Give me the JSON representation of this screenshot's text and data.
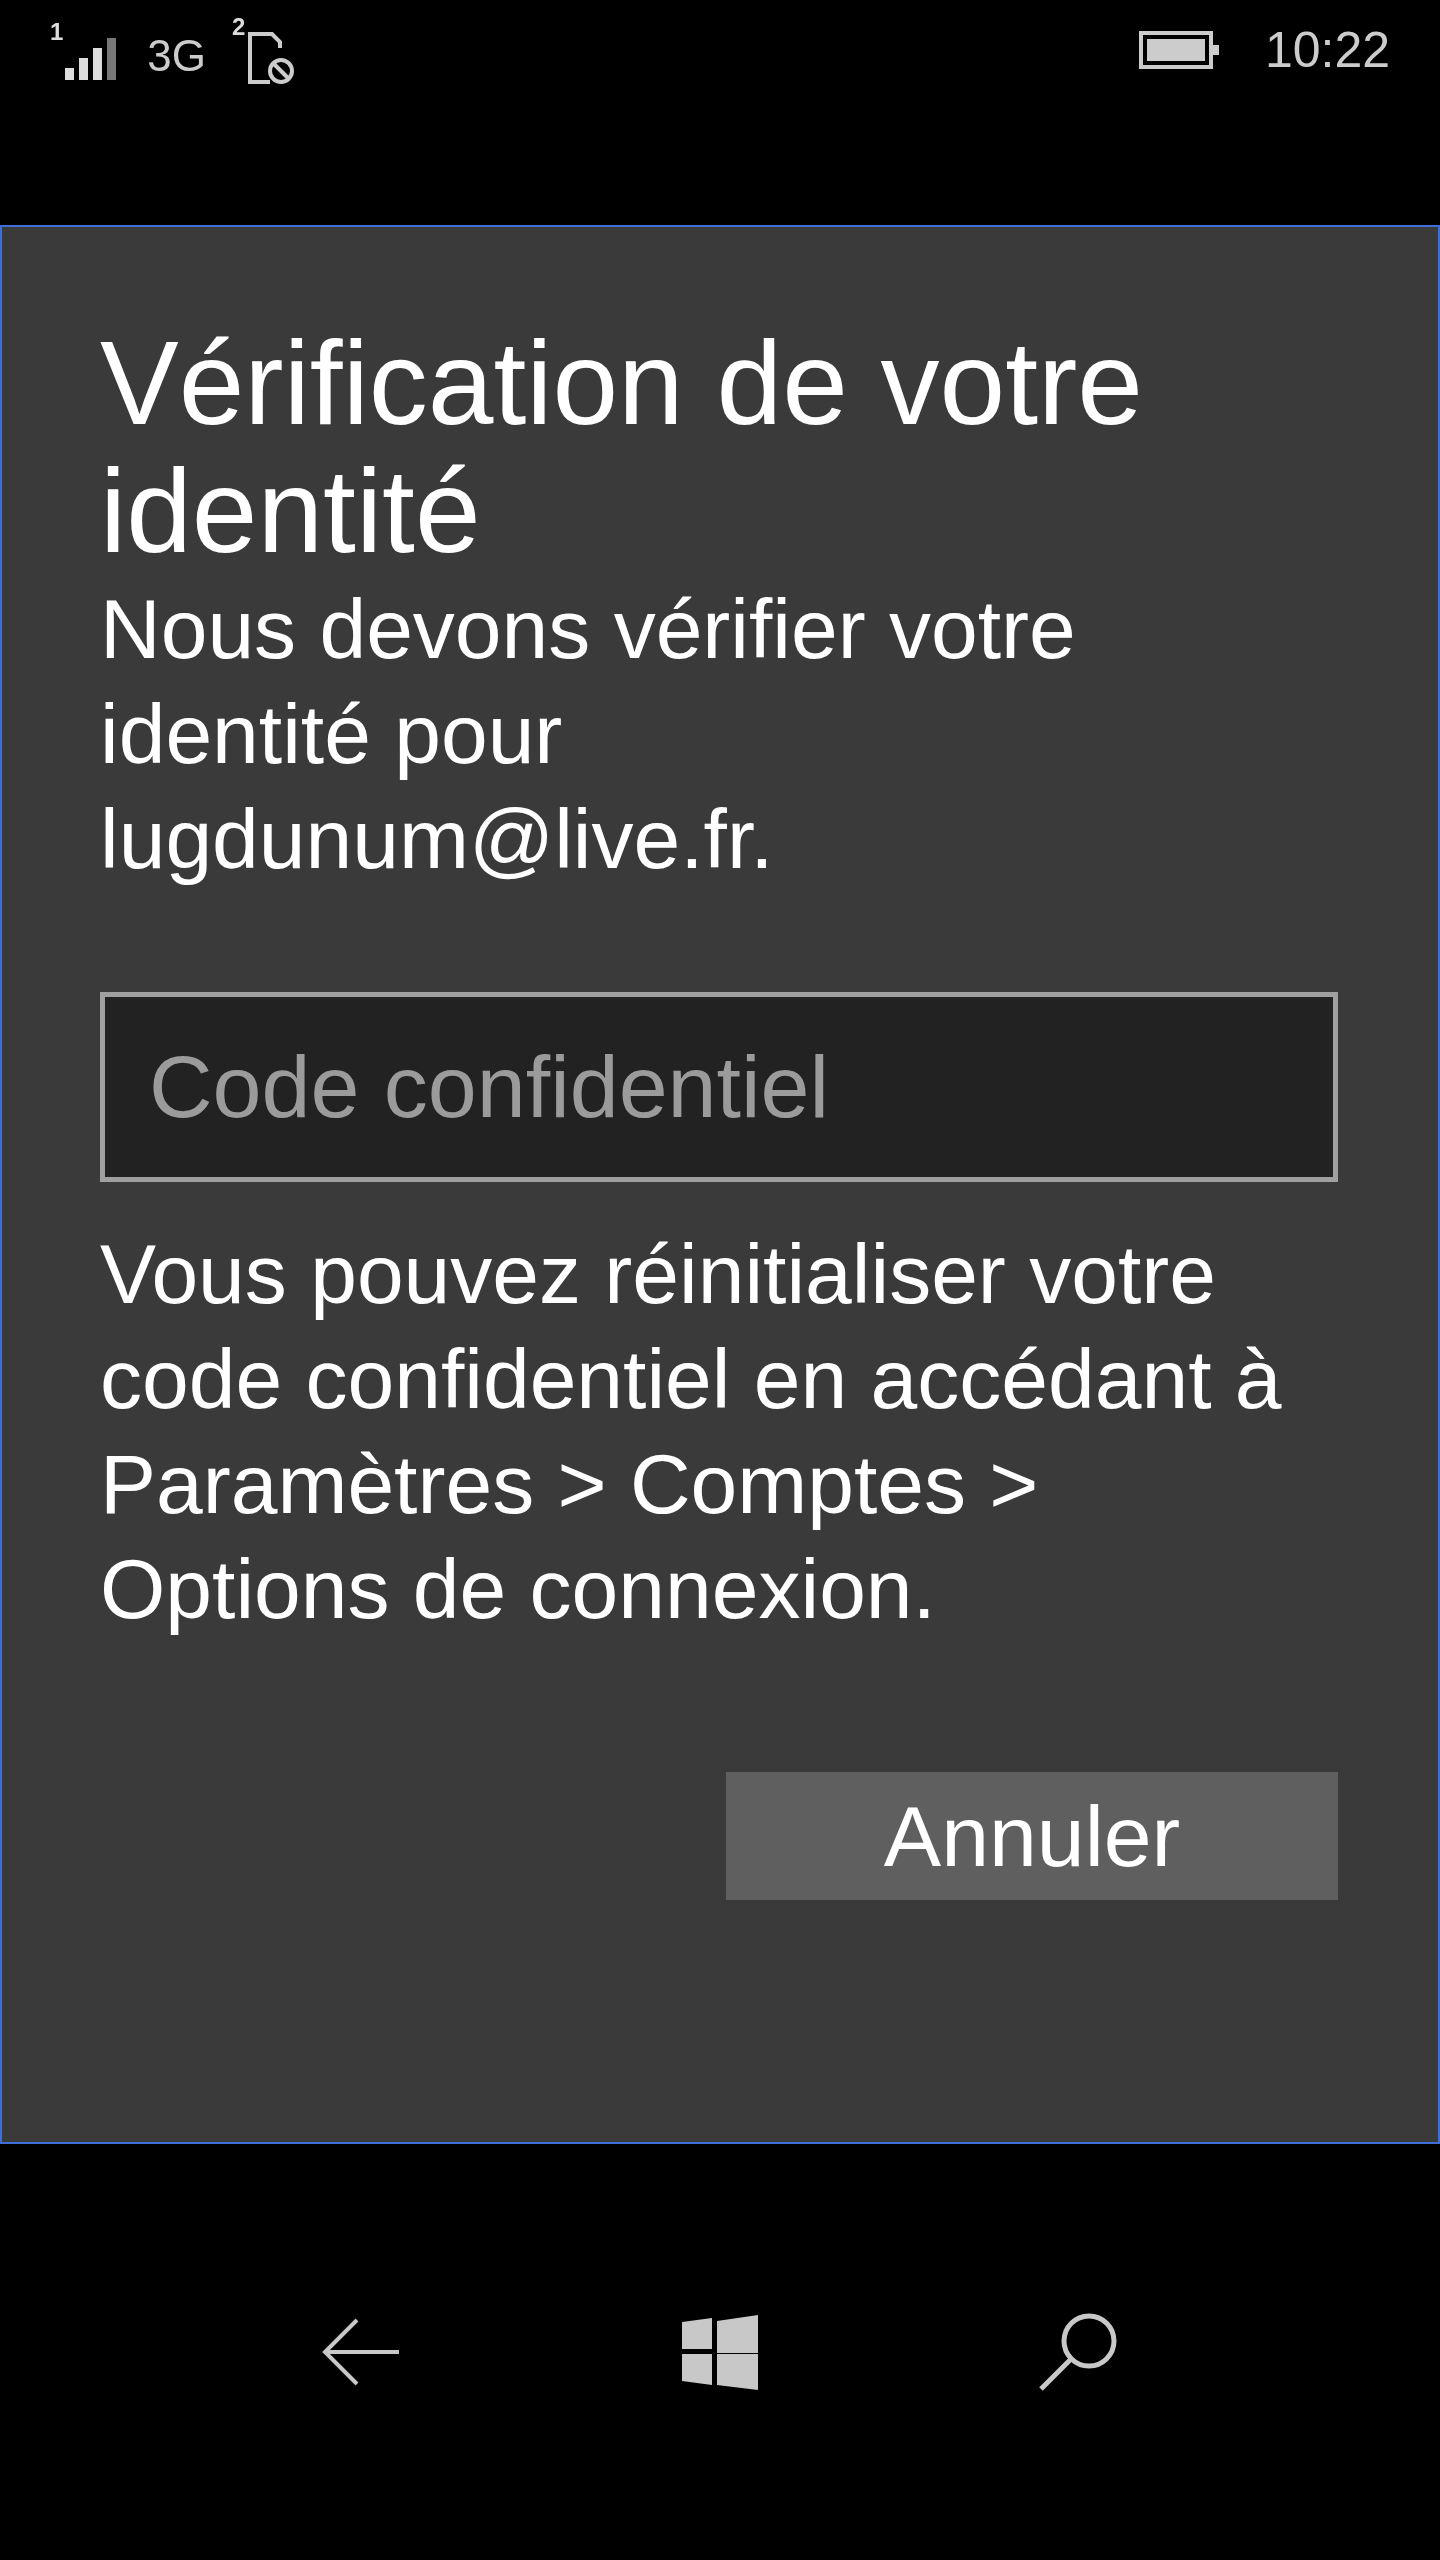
{
  "status_bar": {
    "sim1_label": "1",
    "network": "3G",
    "sim2_label": "2",
    "time": "10:22"
  },
  "dialog": {
    "title": "Vérification de votre identité",
    "message": "Nous devons vérifier votre identité pour lugdunum@live.fr.",
    "pin_field": {
      "placeholder": "Code confidentiel"
    },
    "info": "Vous pouvez réinitialiser votre code confidentiel en accédant à Paramètres > Comptes > Options de connexion.",
    "buttons": [
      "Annuler"
    ]
  },
  "nav_bar": {
    "buttons": [
      {
        "kind": "back"
      },
      {
        "kind": "start"
      },
      {
        "kind": "search"
      }
    ]
  }
}
